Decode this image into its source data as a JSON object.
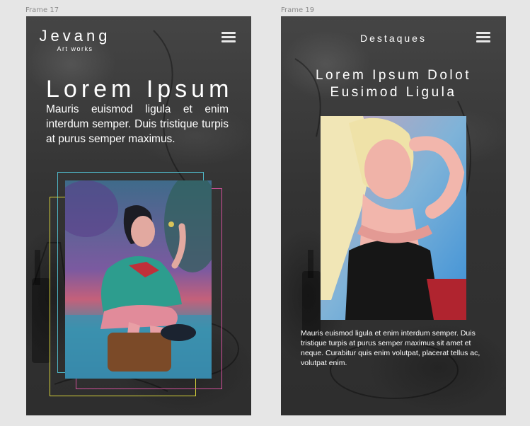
{
  "frames": [
    {
      "label": "Frame 17",
      "logo": {
        "name": "Jevang",
        "subtitle": "Art works"
      },
      "hero": {
        "title": "Lorem Ipsum",
        "text": "Mauris euismod ligula et enim interdum semper. Duis tristique turpis at purus semper maximus."
      }
    },
    {
      "label": "Frame 19",
      "section_title": "Destaques",
      "title_line1": "Lorem Ipsum Dolot",
      "title_line2": "Eusimod Ligula",
      "paragraph": "Mauris euismod ligula et enim interdum semper. Duis tristique turpis at purus semper maximus sit amet et neque. Curabitur quis enim volutpat, placerat tellus ac, volutpat enim."
    }
  ],
  "colors": {
    "canvas": "#e6e6e6",
    "frame_bg": "#3a3a3a",
    "text": "#ffffff",
    "accent_cyan": "#4fb8c8",
    "accent_yellow": "#d6d23a",
    "accent_magenta": "#d0509a"
  },
  "icons": {
    "menu": "hamburger-menu-icon"
  }
}
